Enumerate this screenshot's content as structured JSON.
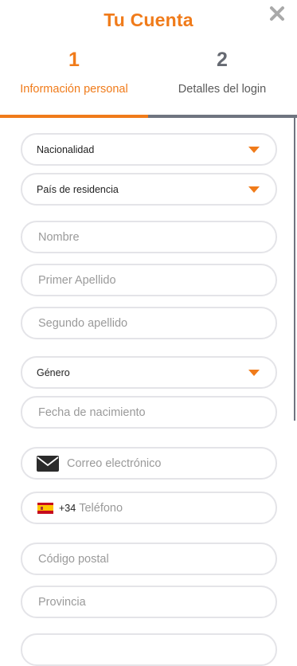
{
  "header": {
    "title": "Tu Cuenta"
  },
  "steps": [
    {
      "number": "1",
      "label": "Información personal"
    },
    {
      "number": "2",
      "label": "Detalles del login"
    }
  ],
  "fields": {
    "nacionalidad": "Nacionalidad",
    "pais_residencia": "País de residencia",
    "nombre": "Nombre",
    "primer_apellido": "Primer Apellido",
    "segundo_apellido": "Segundo apellido",
    "genero": "Género",
    "fecha_nacimiento": "Fecha de nacimiento",
    "correo": "Correo electrónico",
    "telefono_prefijo": "+34",
    "telefono": "Teléfono",
    "codigo_postal": "Código postal",
    "provincia": "Provincia"
  },
  "colors": {
    "accent": "#f07b1a",
    "inactive": "#6f7580",
    "field_border": "#e4e4e8",
    "placeholder": "#9a9a9a"
  },
  "icons": [
    "close-icon",
    "chevron-down-icon",
    "mail-icon",
    "spain-flag-icon"
  ]
}
